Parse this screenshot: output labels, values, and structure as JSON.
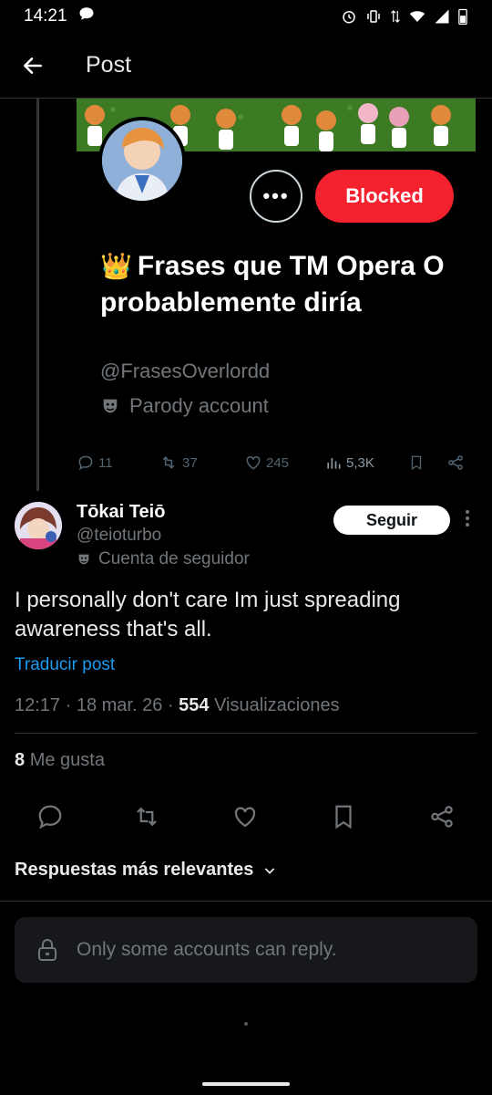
{
  "status_bar": {
    "time": "14:21"
  },
  "header": {
    "title": "Post"
  },
  "quoted_profile": {
    "more_label": "•••",
    "blocked_label": "Blocked",
    "crown_emoji": "👑",
    "display_name": "Frases que TM Opera O probablemente diría",
    "handle": "@FrasesOverlordd",
    "parody_label": "Parody account",
    "stats": {
      "replies": "11",
      "reposts": "37",
      "likes": "245",
      "views": "5,3K"
    }
  },
  "reply": {
    "name": "Tōkai Teiō",
    "handle": "@teioturbo",
    "label": "Cuenta de seguidor",
    "follow_label": "Seguir",
    "text": "I personally don't care Im just spreading awareness that's all.",
    "translate_label": "Traducir post",
    "time": "12:17",
    "date": "18 mar. 26",
    "views_count": "554",
    "views_label": "Visualizaciones",
    "likes_count": "8",
    "likes_label": "Me gusta"
  },
  "replies_sort": {
    "label": "Respuestas más relevantes"
  },
  "reply_restriction": {
    "text": "Only some accounts can reply."
  },
  "colors": {
    "accent": "#1d9bf0",
    "blocked": "#f4212e",
    "background": "#000000"
  }
}
